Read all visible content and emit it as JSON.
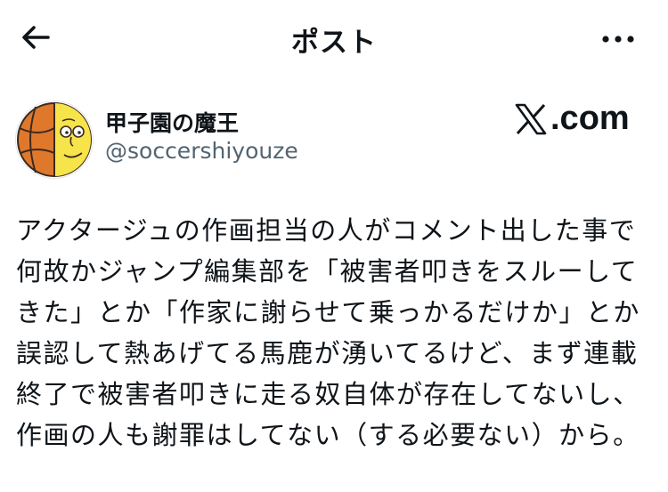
{
  "header": {
    "title": "ポスト",
    "back_icon": "arrow-left-icon",
    "more_icon": "more-horizontal-icon"
  },
  "author": {
    "name": "甲子園の魔王",
    "handle": "@soccershiyouze",
    "avatar_icon": "basketball-face-avatar"
  },
  "source": {
    "label": ".com",
    "icon": "x-logo-icon"
  },
  "post": {
    "lines": [
      "アクタージュの作画担当の人がコメント出した事で",
      "何故かジャンプ編集部を「被害者叩きをスルーして",
      "きた」とか「作家に謝らせて乗っかるだけか」とか",
      "誤認して熱あげてる馬鹿が湧いてるけど、まず連載",
      "終了で被害者叩きに走る奴自体が存在してないし、",
      "作画の人も謝罪はしてない（する必要ない）から。"
    ]
  },
  "colors": {
    "text": "#0f1419",
    "secondary": "#536471",
    "avatar_orange": "#e0782c",
    "avatar_yellow": "#f7e34a"
  }
}
